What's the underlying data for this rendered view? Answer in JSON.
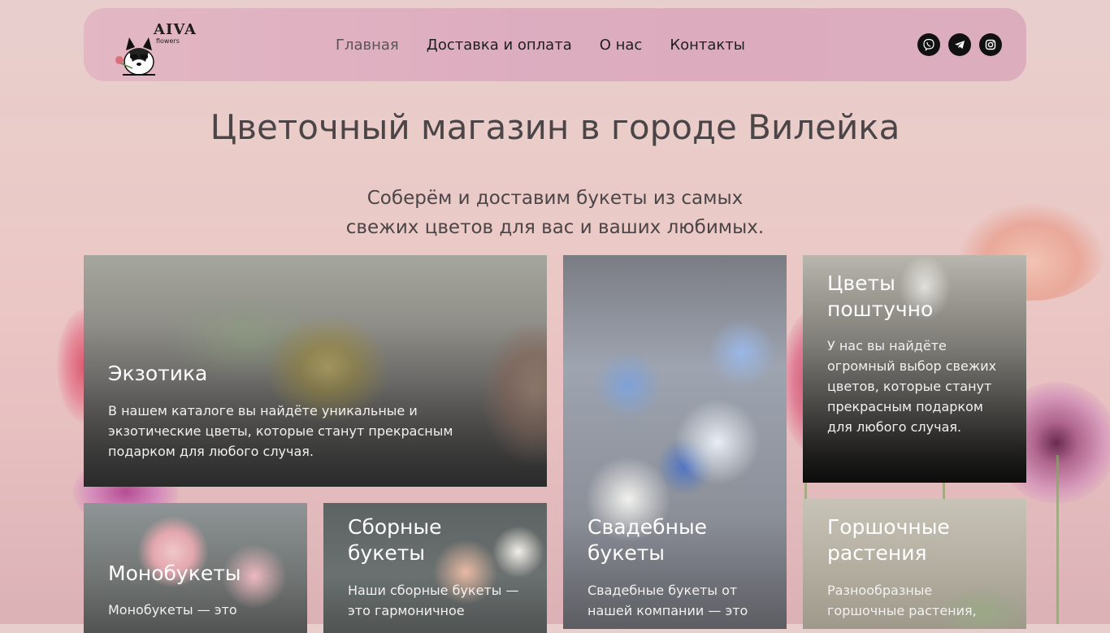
{
  "header": {
    "logo": {
      "name": "AIVA",
      "sub": "flowers"
    },
    "nav": [
      {
        "label": "Главная",
        "active": true
      },
      {
        "label": "Доставка и оплата",
        "active": false
      },
      {
        "label": "О нас",
        "active": false
      },
      {
        "label": "Контакты",
        "active": false
      }
    ],
    "socials": [
      "viber-icon",
      "telegram-icon",
      "instagram-icon"
    ]
  },
  "hero": {
    "title": "Цветочный магазин в городе Вилейка",
    "subtitle_line1": "Соберём и доставим букеты из самых",
    "subtitle_line2": "свежих цветов для вас и ваших любимых."
  },
  "cards": {
    "exotic": {
      "title": "Экзотика",
      "text": "В нашем каталоге вы найдёте уникальные и экзотические цветы, которые станут прекрасным подарком для любого случая."
    },
    "wedding": {
      "title": "Свадебные букеты",
      "text": "Свадебные букеты от нашей компании — это"
    },
    "piece": {
      "title": "Цветы поштучно",
      "text": "У нас вы найдёте огромный выбор свежих цветов, которые станут прекрасным подарком для любого случая."
    },
    "mono": {
      "title": "Монобукеты",
      "text": "Монобукеты — это"
    },
    "mixed": {
      "title": "Сборные букеты",
      "text": "Наши сборные букеты — это гармоничное"
    },
    "potted": {
      "title": "Горшочные растения",
      "text": "Разнообразные горшочные растения,"
    }
  },
  "colors": {
    "header_bg": "#ddafbf",
    "text_dark": "#4b4547",
    "nav_text": "#1e1e1e",
    "social_bg": "#111111"
  }
}
